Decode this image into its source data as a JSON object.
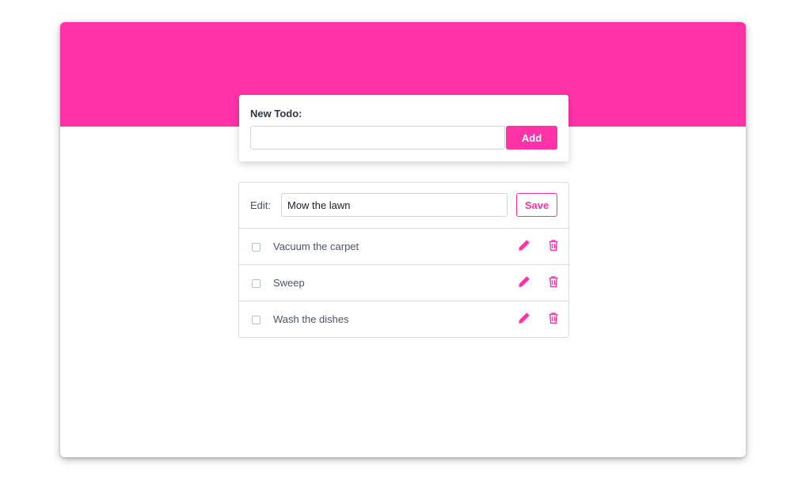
{
  "new_todo": {
    "label": "New Todo:",
    "input_value": "",
    "input_placeholder": "",
    "add_label": "Add"
  },
  "edit": {
    "label": "Edit:",
    "input_value": "Mow the lawn",
    "save_label": "Save"
  },
  "todos": [
    {
      "text": "Vacuum the carpet",
      "done": false
    },
    {
      "text": "Sweep",
      "done": false
    },
    {
      "text": "Wash the dishes",
      "done": false
    }
  ],
  "icons": {
    "edit": "pencil-icon",
    "delete": "trash-icon"
  },
  "colors": {
    "accent": "#ff33a7",
    "text": "#4a5568",
    "border": "#d8dbe0"
  }
}
